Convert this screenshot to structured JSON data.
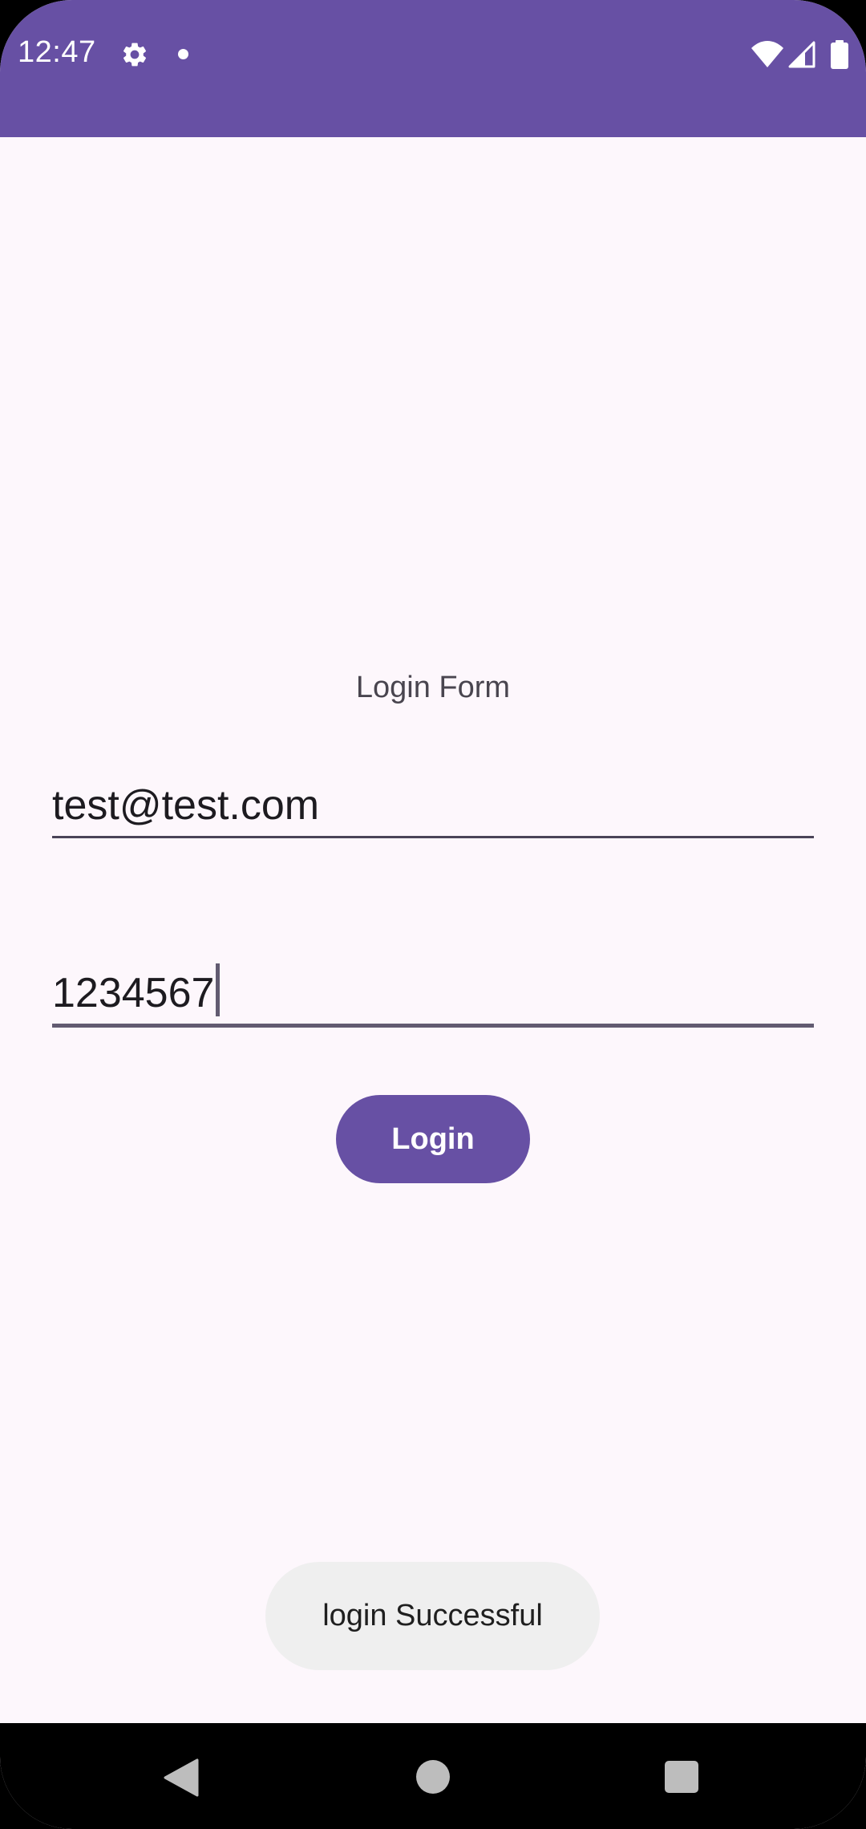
{
  "status_bar": {
    "time": "12:47",
    "background_color": "#6750A4",
    "icons": [
      "gear-icon",
      "notification-dot-icon",
      "wifi-icon",
      "signal-icon",
      "battery-icon"
    ]
  },
  "form": {
    "title": "Login Form",
    "email_value": "test@test.com",
    "password_value": "1234567",
    "login_label": "Login"
  },
  "toast": {
    "message": "login Successful"
  },
  "navigation": {
    "icons": [
      "back-icon",
      "home-icon",
      "recents-icon"
    ]
  },
  "colors": {
    "primary": "#6750A4",
    "background": "#FDF7FC",
    "toast_background": "#EFEFEF"
  }
}
